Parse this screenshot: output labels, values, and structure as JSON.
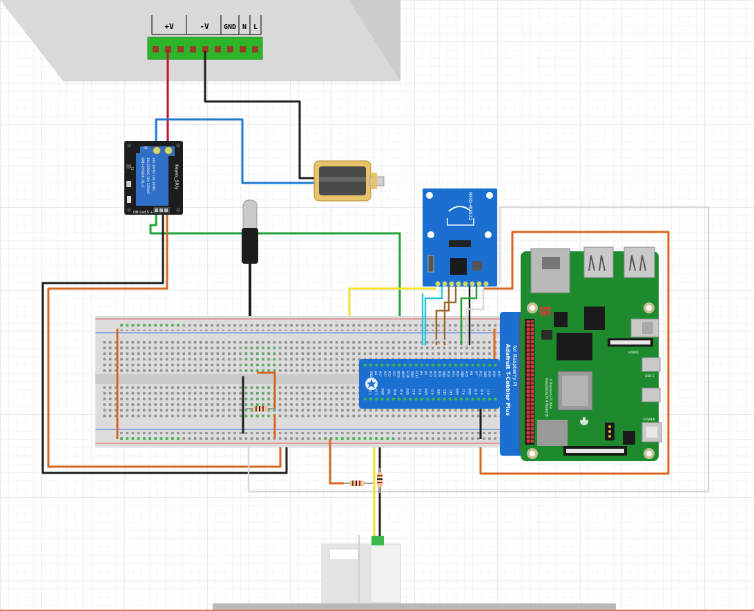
{
  "power_supply": {
    "terminals": [
      "+V",
      "-V",
      "GND",
      "N",
      "L"
    ]
  },
  "relay": {
    "labels": {
      "nc": "NC",
      "model": "SRD-05VDC-SL-C",
      "rating1": "10A 250VAC 10A 125VAC",
      "rating2": "10A 30VDC 10A 28VDC",
      "brand": "Keyes_SRly",
      "pins": "ON Led S + -",
      "led": "J1"
    }
  },
  "rfid": {
    "label": "RFID-RC522"
  },
  "cobbler": {
    "title": "Adafruit T-Cobbler Plus",
    "subtitle": "for Raspberry Pi",
    "top_pins": [
      "GND",
      "#4",
      "#17",
      "#27",
      "#22",
      "3V3",
      "MOSI",
      "MISO",
      "SCLK",
      "GND",
      "ECE1",
      "#5",
      "#6",
      "#13",
      "#19",
      "#26",
      "GND",
      "#18",
      "#23",
      "#24",
      "GND",
      "#25",
      "#8",
      "#7",
      "#12",
      "GND",
      "#16",
      "#20",
      "#21"
    ],
    "bottom_pins": [
      "5.0V",
      "5.0V",
      "GND",
      "TXD",
      "RXD",
      "#18",
      "GND",
      "#23",
      "#24",
      "GND",
      "#25",
      "CE0",
      "CE1",
      "EEC",
      "GND",
      "#12",
      "GND",
      "#16",
      "#20",
      "#21"
    ]
  },
  "raspberry_pi": {
    "label1": "Raspberry Pi 4 Model B",
    "label2": "© Raspberry Pi 2018",
    "hdmi_label": "HDMI0",
    "usb_label": "USB C",
    "pwr_label": "POWER"
  },
  "colors": {
    "wire_red": "#c8102e",
    "wire_black": "#1c1c1c",
    "wire_blue": "#1f78d1",
    "wire_green": "#21a336",
    "wire_orange": "#d9661f",
    "wire_yellow": "#f2e02a",
    "wire_white": "#d8d8d8",
    "wire_brown": "#9a6a2c",
    "wire_cyan": "#2ec6d6",
    "pcb_blue": "#1b6fd1",
    "pcb_green": "#1e8a2e",
    "terminal_green": "#2db52a"
  }
}
